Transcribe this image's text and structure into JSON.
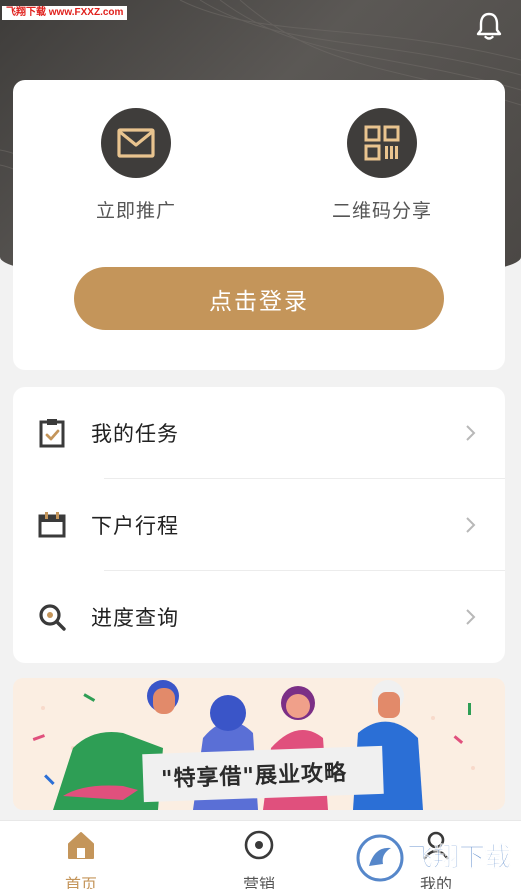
{
  "watermark_top": "飞翔下载 www.FXXZ.com",
  "actions": [
    {
      "label": "立即推广",
      "icon": "envelope-icon"
    },
    {
      "label": "二维码分享",
      "icon": "qrcode-icon"
    }
  ],
  "login_label": "点击登录",
  "menu": [
    {
      "label": "我的任务",
      "icon": "task-clipboard-icon"
    },
    {
      "label": "下户行程",
      "icon": "schedule-calendar-icon"
    },
    {
      "label": "进度查询",
      "icon": "search-icon"
    }
  ],
  "banner": {
    "title": "\"特享借\"展业攻略"
  },
  "tabs": [
    {
      "label": "首页",
      "icon": "home-icon",
      "active": true
    },
    {
      "label": "营销",
      "icon": "marketing-circle-icon",
      "active": false
    },
    {
      "label": "我的",
      "icon": "user-icon",
      "active": false
    }
  ],
  "watermark_logo": "飞翔下载",
  "colors": {
    "accent": "#c4955a",
    "dark": "#3f3d3b",
    "bg": "#f2f2f2"
  }
}
